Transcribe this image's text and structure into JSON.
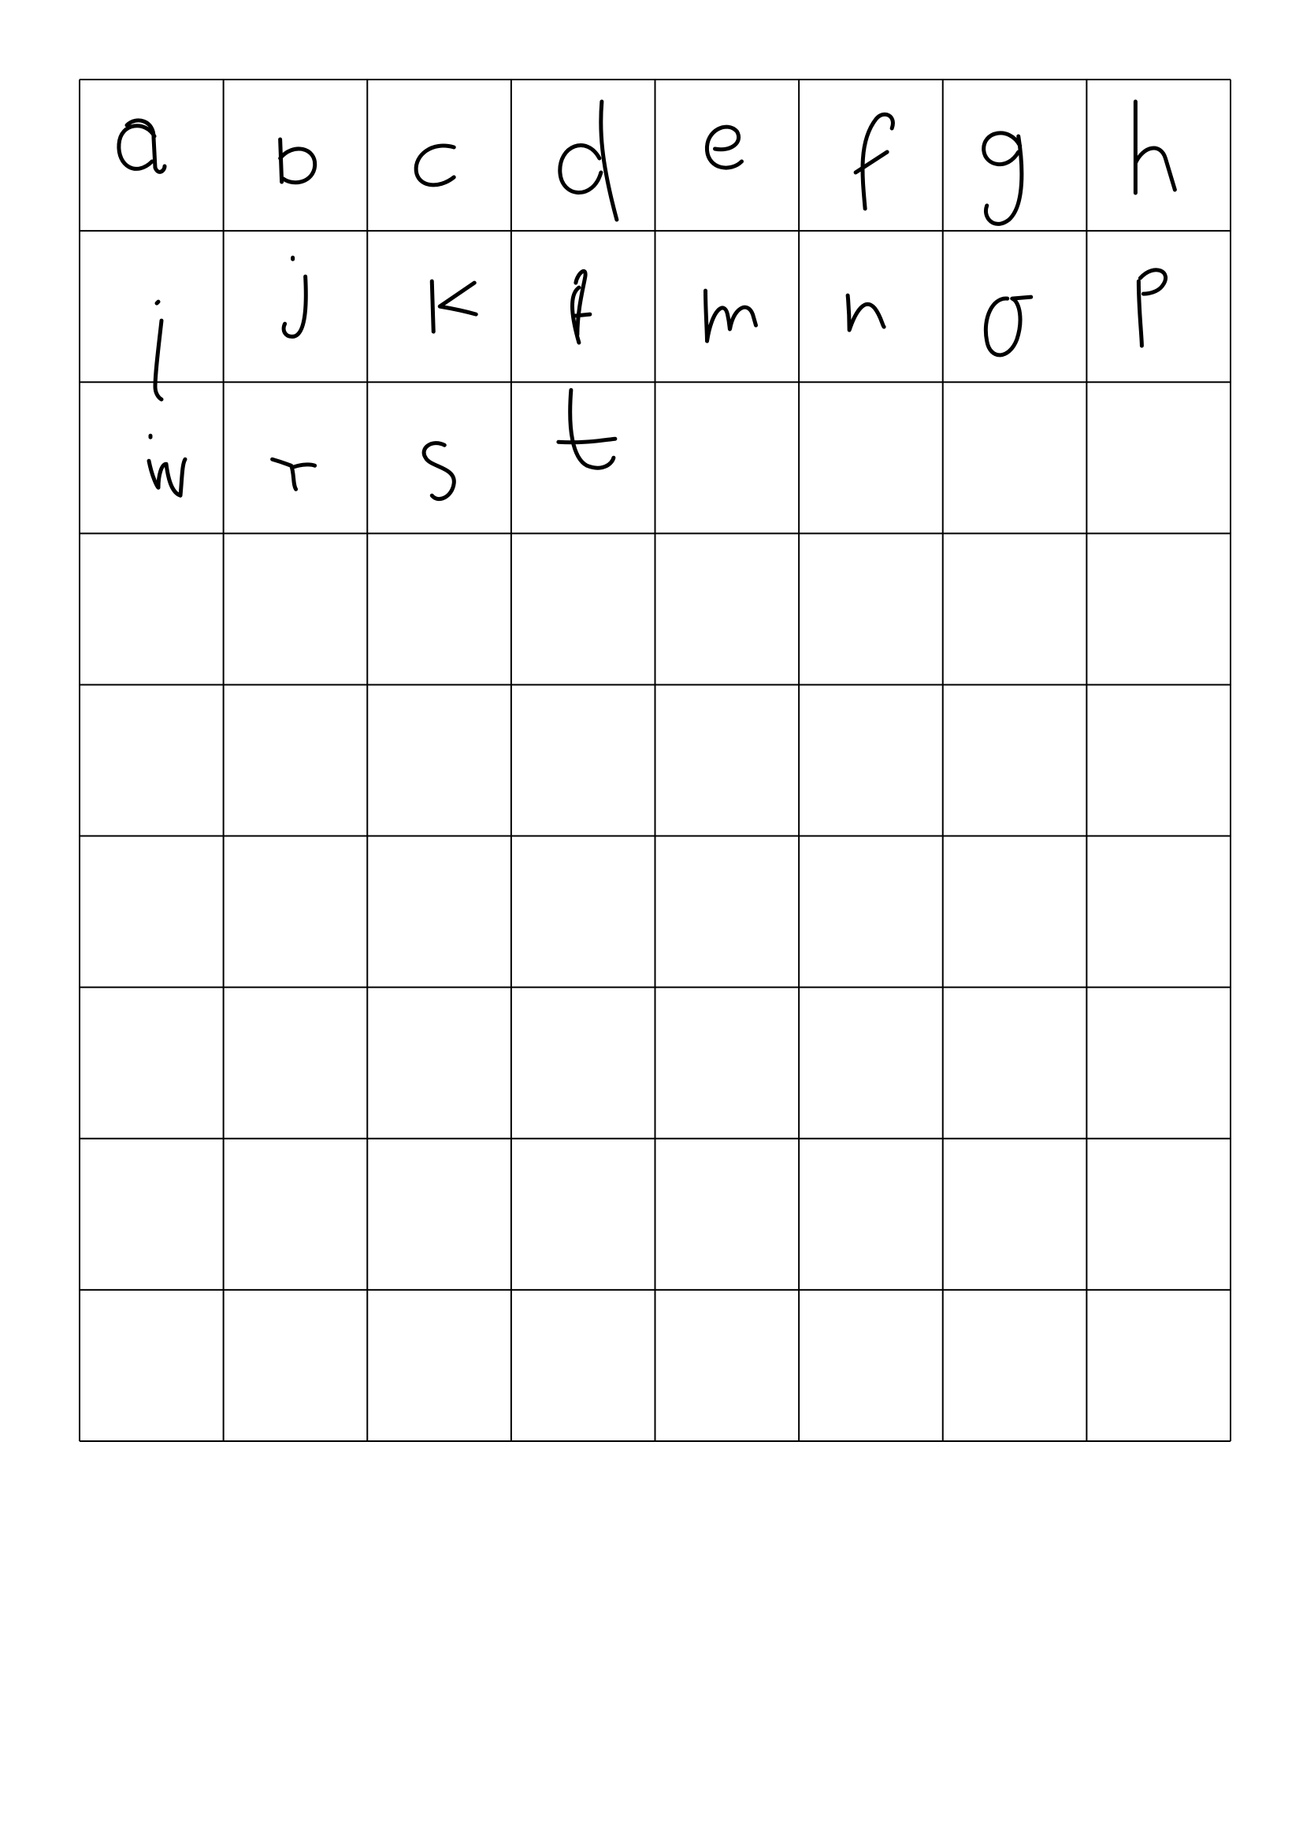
{
  "worksheet": {
    "rows": 9,
    "columns": 8,
    "cells": [
      [
        "a",
        "b",
        "c",
        "d",
        "e",
        "f",
        "g",
        "h"
      ],
      [
        "i",
        "j",
        "k",
        "l",
        "m",
        "n",
        "o",
        "p"
      ],
      [
        "w",
        "r",
        "s",
        "t",
        "",
        "",
        "",
        ""
      ],
      [
        "",
        "",
        "",
        "",
        "",
        "",
        "",
        ""
      ],
      [
        "",
        "",
        "",
        "",
        "",
        "",
        "",
        ""
      ],
      [
        "",
        "",
        "",
        "",
        "",
        "",
        "",
        ""
      ],
      [
        "",
        "",
        "",
        "",
        "",
        "",
        "",
        ""
      ],
      [
        "",
        "",
        "",
        "",
        "",
        "",
        "",
        ""
      ],
      [
        "",
        "",
        "",
        "",
        "",
        "",
        "",
        ""
      ]
    ],
    "ink_color": "#000000",
    "line_color": "#000000",
    "background_color": "#ffffff"
  }
}
